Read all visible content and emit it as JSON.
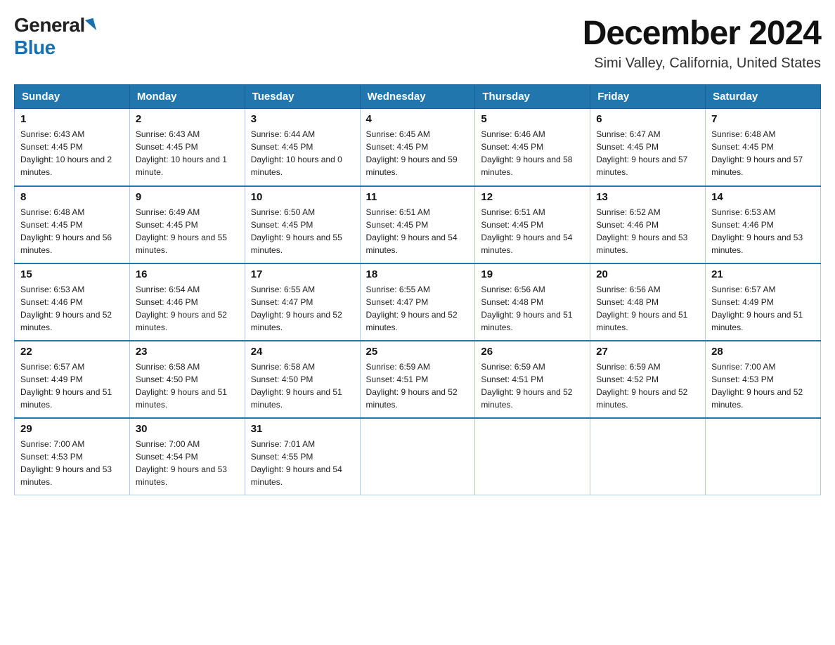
{
  "header": {
    "logo_general": "General",
    "logo_blue": "Blue",
    "month_title": "December 2024",
    "location": "Simi Valley, California, United States"
  },
  "weekdays": [
    "Sunday",
    "Monday",
    "Tuesday",
    "Wednesday",
    "Thursday",
    "Friday",
    "Saturday"
  ],
  "weeks": [
    [
      {
        "day": "1",
        "sunrise": "6:43 AM",
        "sunset": "4:45 PM",
        "daylight": "10 hours and 2 minutes."
      },
      {
        "day": "2",
        "sunrise": "6:43 AM",
        "sunset": "4:45 PM",
        "daylight": "10 hours and 1 minute."
      },
      {
        "day": "3",
        "sunrise": "6:44 AM",
        "sunset": "4:45 PM",
        "daylight": "10 hours and 0 minutes."
      },
      {
        "day": "4",
        "sunrise": "6:45 AM",
        "sunset": "4:45 PM",
        "daylight": "9 hours and 59 minutes."
      },
      {
        "day": "5",
        "sunrise": "6:46 AM",
        "sunset": "4:45 PM",
        "daylight": "9 hours and 58 minutes."
      },
      {
        "day": "6",
        "sunrise": "6:47 AM",
        "sunset": "4:45 PM",
        "daylight": "9 hours and 57 minutes."
      },
      {
        "day": "7",
        "sunrise": "6:48 AM",
        "sunset": "4:45 PM",
        "daylight": "9 hours and 57 minutes."
      }
    ],
    [
      {
        "day": "8",
        "sunrise": "6:48 AM",
        "sunset": "4:45 PM",
        "daylight": "9 hours and 56 minutes."
      },
      {
        "day": "9",
        "sunrise": "6:49 AM",
        "sunset": "4:45 PM",
        "daylight": "9 hours and 55 minutes."
      },
      {
        "day": "10",
        "sunrise": "6:50 AM",
        "sunset": "4:45 PM",
        "daylight": "9 hours and 55 minutes."
      },
      {
        "day": "11",
        "sunrise": "6:51 AM",
        "sunset": "4:45 PM",
        "daylight": "9 hours and 54 minutes."
      },
      {
        "day": "12",
        "sunrise": "6:51 AM",
        "sunset": "4:45 PM",
        "daylight": "9 hours and 54 minutes."
      },
      {
        "day": "13",
        "sunrise": "6:52 AM",
        "sunset": "4:46 PM",
        "daylight": "9 hours and 53 minutes."
      },
      {
        "day": "14",
        "sunrise": "6:53 AM",
        "sunset": "4:46 PM",
        "daylight": "9 hours and 53 minutes."
      }
    ],
    [
      {
        "day": "15",
        "sunrise": "6:53 AM",
        "sunset": "4:46 PM",
        "daylight": "9 hours and 52 minutes."
      },
      {
        "day": "16",
        "sunrise": "6:54 AM",
        "sunset": "4:46 PM",
        "daylight": "9 hours and 52 minutes."
      },
      {
        "day": "17",
        "sunrise": "6:55 AM",
        "sunset": "4:47 PM",
        "daylight": "9 hours and 52 minutes."
      },
      {
        "day": "18",
        "sunrise": "6:55 AM",
        "sunset": "4:47 PM",
        "daylight": "9 hours and 52 minutes."
      },
      {
        "day": "19",
        "sunrise": "6:56 AM",
        "sunset": "4:48 PM",
        "daylight": "9 hours and 51 minutes."
      },
      {
        "day": "20",
        "sunrise": "6:56 AM",
        "sunset": "4:48 PM",
        "daylight": "9 hours and 51 minutes."
      },
      {
        "day": "21",
        "sunrise": "6:57 AM",
        "sunset": "4:49 PM",
        "daylight": "9 hours and 51 minutes."
      }
    ],
    [
      {
        "day": "22",
        "sunrise": "6:57 AM",
        "sunset": "4:49 PM",
        "daylight": "9 hours and 51 minutes."
      },
      {
        "day": "23",
        "sunrise": "6:58 AM",
        "sunset": "4:50 PM",
        "daylight": "9 hours and 51 minutes."
      },
      {
        "day": "24",
        "sunrise": "6:58 AM",
        "sunset": "4:50 PM",
        "daylight": "9 hours and 51 minutes."
      },
      {
        "day": "25",
        "sunrise": "6:59 AM",
        "sunset": "4:51 PM",
        "daylight": "9 hours and 52 minutes."
      },
      {
        "day": "26",
        "sunrise": "6:59 AM",
        "sunset": "4:51 PM",
        "daylight": "9 hours and 52 minutes."
      },
      {
        "day": "27",
        "sunrise": "6:59 AM",
        "sunset": "4:52 PM",
        "daylight": "9 hours and 52 minutes."
      },
      {
        "day": "28",
        "sunrise": "7:00 AM",
        "sunset": "4:53 PM",
        "daylight": "9 hours and 52 minutes."
      }
    ],
    [
      {
        "day": "29",
        "sunrise": "7:00 AM",
        "sunset": "4:53 PM",
        "daylight": "9 hours and 53 minutes."
      },
      {
        "day": "30",
        "sunrise": "7:00 AM",
        "sunset": "4:54 PM",
        "daylight": "9 hours and 53 minutes."
      },
      {
        "day": "31",
        "sunrise": "7:01 AM",
        "sunset": "4:55 PM",
        "daylight": "9 hours and 54 minutes."
      },
      null,
      null,
      null,
      null
    ]
  ]
}
